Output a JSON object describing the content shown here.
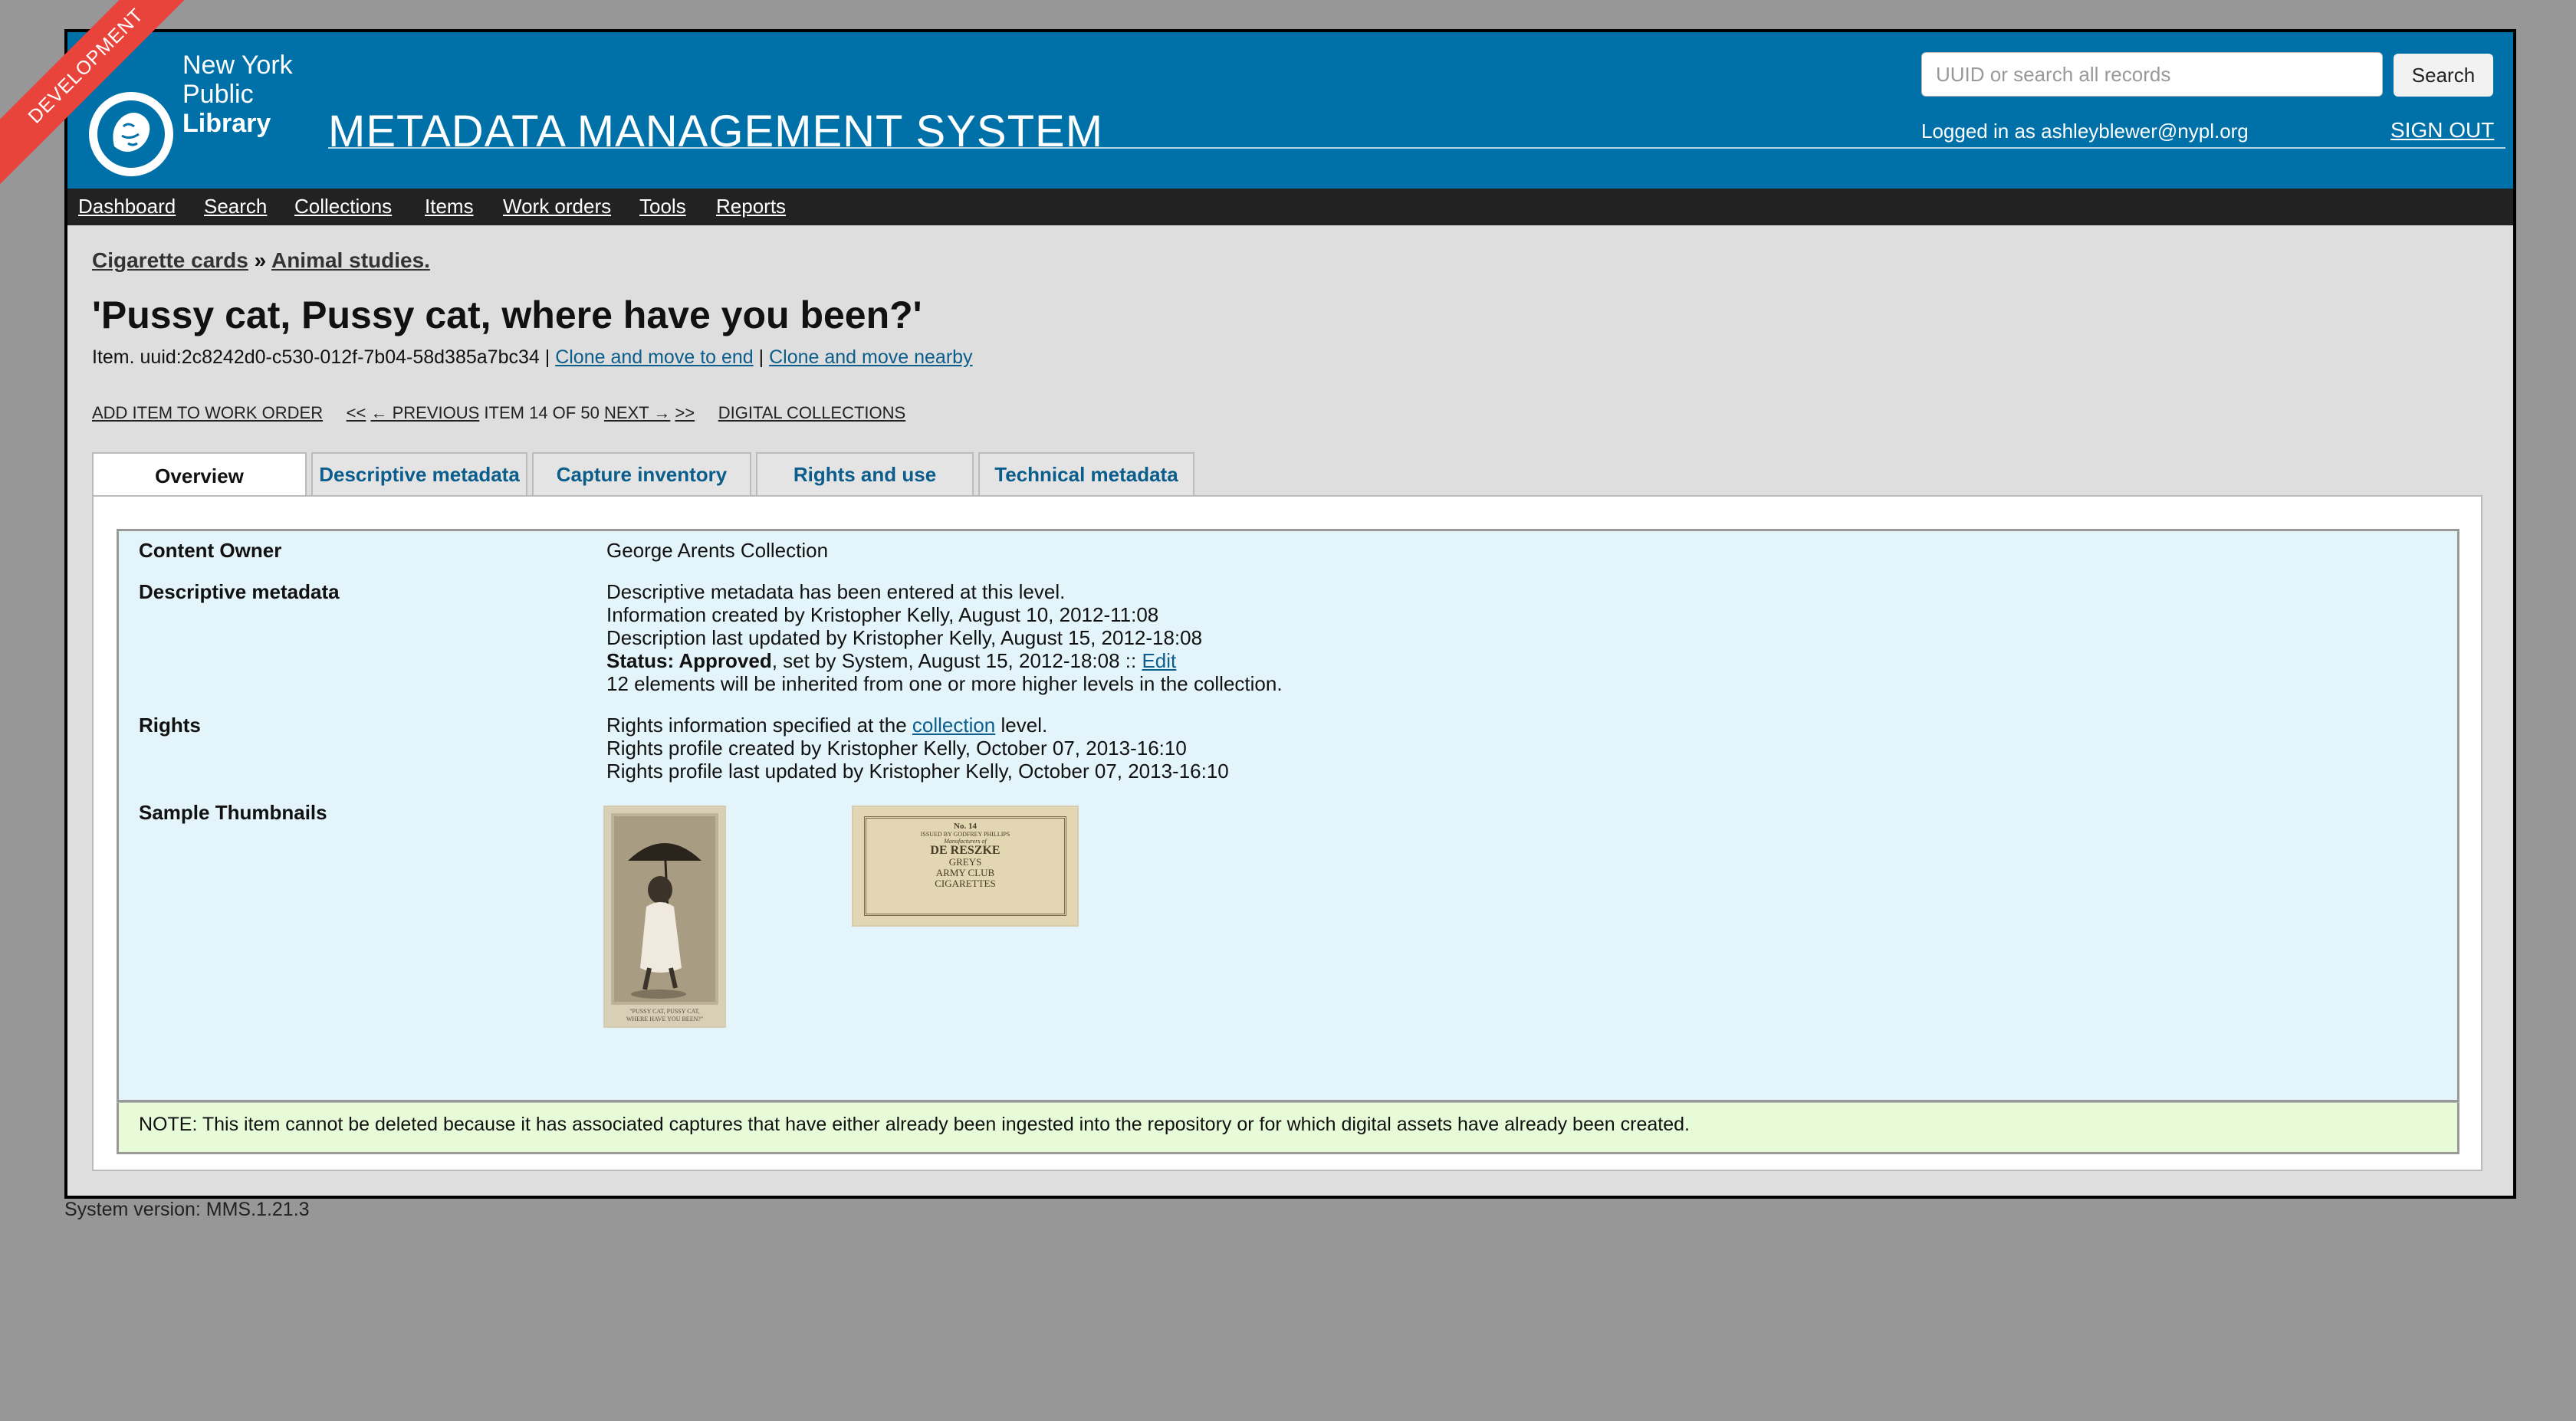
{
  "header": {
    "logo_lines": [
      "New York",
      "Public",
      "Library"
    ],
    "app_title": "METADATA MANAGEMENT SYSTEM",
    "search": {
      "placeholder": "UUID or search all records",
      "button_label": "Search"
    },
    "logged_in_text": "Logged in as ashleyblewer@nypl.org",
    "sign_out_label": "SIGN OUT"
  },
  "dev_banner": "DEVELOPMENT",
  "nav": [
    "Dashboard",
    "Search",
    "Collections",
    "Items",
    "Work orders",
    "Tools",
    "Reports"
  ],
  "breadcrumb": {
    "parent": "Cigarette cards",
    "separator": "»",
    "current": "Animal studies."
  },
  "title": "'Pussy cat, Pussy cat, where have you been?'",
  "item_line": {
    "prefix": "Item. uuid:2c8242d0-c530-012f-7b04-58d385a7bc34",
    "sep": "|",
    "clone_end": "Clone and move to end",
    "clone_nearby": "Clone and move nearby"
  },
  "actions": {
    "add_to_work_order": "ADD ITEM TO WORK ORDER",
    "first": "<<",
    "previous": "← PREVIOUS",
    "position": "ITEM 14 OF 50",
    "next": "NEXT →",
    "last": ">>",
    "digital_collections": "DIGITAL COLLECTIONS"
  },
  "tabs": [
    "Overview",
    "Descriptive metadata",
    "Capture inventory",
    "Rights and use",
    "Technical metadata"
  ],
  "active_tab": "Overview",
  "overview": {
    "content_owner": {
      "label": "Content Owner",
      "value": "George Arents Collection"
    },
    "descriptive": {
      "label": "Descriptive metadata",
      "line1": "Descriptive metadata has been entered at this level.",
      "line2": "Information created by Kristopher Kelly, August 10, 2012-11:08",
      "line3": "Description last updated by Kristopher Kelly, August 15, 2012-18:08",
      "status_label": "Status: Approved",
      "status_rest": ", set by System, August 15, 2012-18:08 :: ",
      "edit_link": "Edit",
      "line5": "12 elements will be inherited from one or more higher levels in the collection."
    },
    "rights": {
      "label": "Rights",
      "line1_before": "Rights information specified at the ",
      "line1_link": "collection",
      "line1_after": " level.",
      "line2": "Rights profile created by Kristopher Kelly, October 07, 2013-16:10",
      "line3": "Rights profile last updated by Kristopher Kelly, October 07, 2013-16:10"
    },
    "thumbnails": {
      "label": "Sample Thumbnails",
      "card_back": [
        "No. 14",
        "ISSUED BY GODFREY PHILLIPS",
        "Manufacturers of",
        "DE RESZKE",
        "GREYS",
        "ARMY CLUB",
        "CIGARETTES"
      ],
      "card_front_caption": [
        "\"PUSSY CAT, PUSSY CAT,",
        "WHERE HAVE YOU BEEN?\""
      ]
    },
    "note": "NOTE: This item cannot be deleted because it has associated captures that have either already been ingested into the repository or for which digital assets have already been created."
  },
  "footer": {
    "version": "System version: MMS.1.21.3"
  }
}
